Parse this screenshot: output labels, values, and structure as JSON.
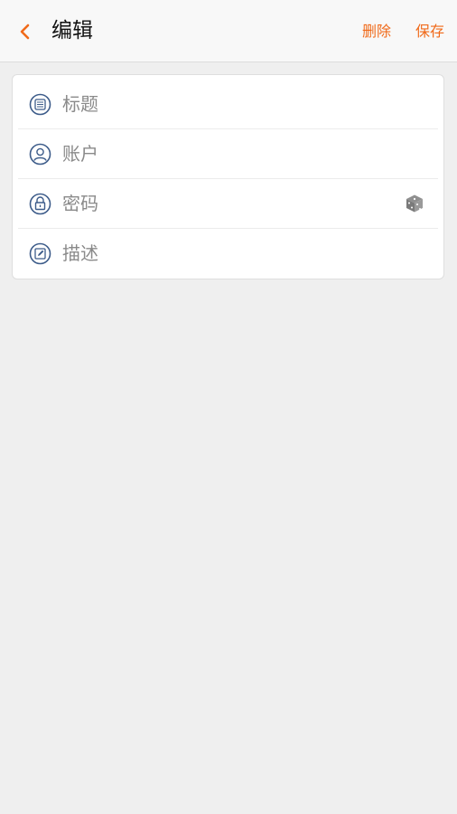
{
  "header": {
    "title": "编辑",
    "delete_label": "删除",
    "save_label": "保存"
  },
  "form": {
    "fields": [
      {
        "placeholder": "标题",
        "icon": "title-icon"
      },
      {
        "placeholder": "账户",
        "icon": "account-icon"
      },
      {
        "placeholder": "密码",
        "icon": "lock-icon"
      },
      {
        "placeholder": "描述",
        "icon": "description-icon"
      }
    ],
    "generate_icon": "dice-icon"
  },
  "colors": {
    "accent": "#f06a1a",
    "icon": "#3d5c8a",
    "placeholder": "#8a8a8a",
    "background": "#efefef"
  }
}
